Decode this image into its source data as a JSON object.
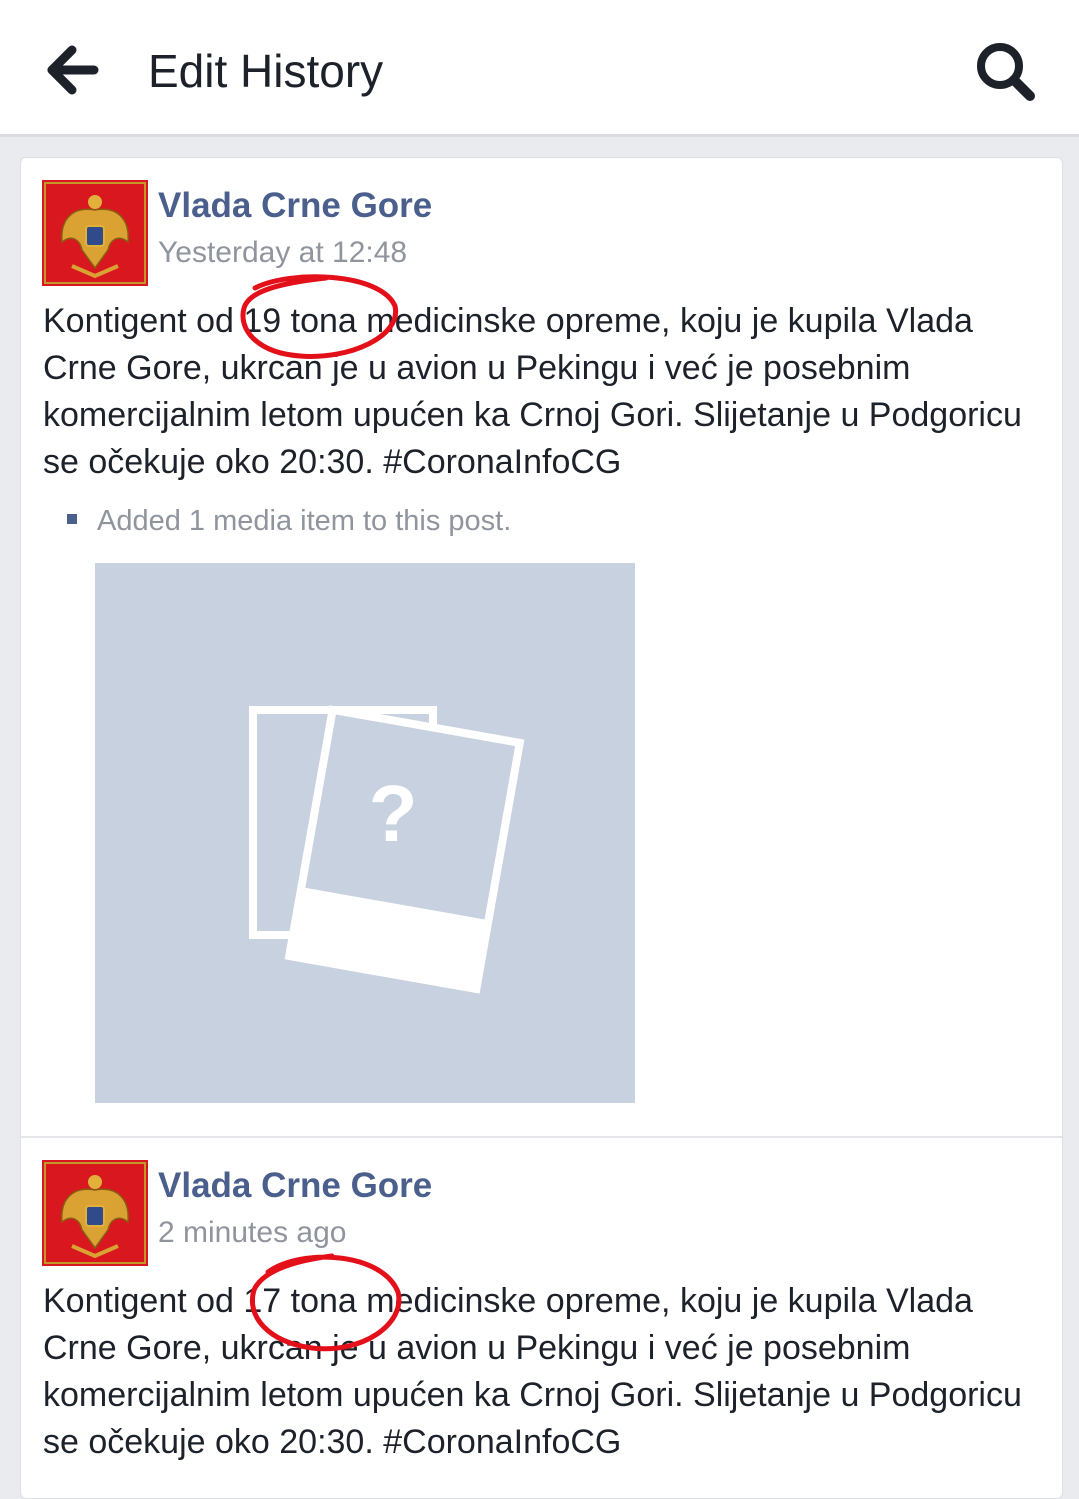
{
  "header": {
    "title": "Edit History",
    "back_icon": "back-arrow-icon",
    "search_icon": "search-icon"
  },
  "entries": [
    {
      "author": "Vlada Crne Gore",
      "time": "Yesterday at 12:48",
      "text": "Kontigent od 19 tona medicinske opreme, koju je kupila Vlada Crne Gore, ukrcan je u avion u Pekingu i već je posebnim komercijalnim letom upućen ka Crnoj Gori. Slijetanje u Podgoricu se očekuje oko 20:30. #CoronaInfoCG",
      "change_note": "Added 1 media item to this post.",
      "media_placeholder": "?"
    },
    {
      "author": "Vlada Crne Gore",
      "time": "2 minutes ago",
      "text": "Kontigent od 17 tona medicinske opreme, koju je kupila Vlada Crne Gore, ukrcan je u avion u Pekingu i već je posebnim komercijalnim letom upućen ka Crnoj Gori. Slijetanje u Podgoricu se očekuje oko 20:30. #CoronaInfoCG"
    }
  ],
  "colors": {
    "author": "#4b5f8c",
    "meta": "#90949c",
    "annotation": "#e3101a",
    "avatar_bg": "#d8171f"
  }
}
